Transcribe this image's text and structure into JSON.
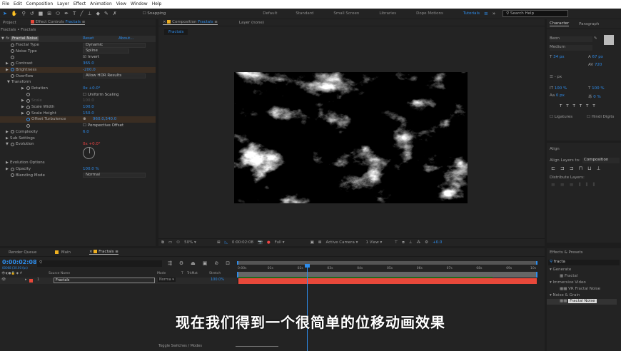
{
  "menu": [
    "File",
    "Edit",
    "Composition",
    "Layer",
    "Effect",
    "Animation",
    "View",
    "Window",
    "Help"
  ],
  "toolbar": {
    "snapping": "Snapping",
    "workspaces": [
      "Default",
      "Standard",
      "Small Screen",
      "Libraries",
      "Dope Motions",
      "Tutorials"
    ],
    "active_workspace": "Tutorials",
    "search_placeholder": "Search Help"
  },
  "left": {
    "tab_project": "Project",
    "tab_effect": "Effect Controls",
    "tab_effect_layer": "Fractals",
    "crumb": "Fractals • Fractals",
    "effect_name": "Fractal Noise",
    "reset": "Reset",
    "about": "About...",
    "props": [
      {
        "label": "Fractal Type",
        "value": "Dynamic",
        "type": "dropdown"
      },
      {
        "label": "Noise Type",
        "value": "Spline",
        "type": "dropdown"
      },
      {
        "label": "",
        "value": "Invert",
        "type": "checkbox",
        "checked": true
      },
      {
        "label": "Contrast",
        "value": "365.0"
      },
      {
        "label": "Brightness",
        "value": "-200.0"
      },
      {
        "label": "Overflow",
        "value": "Allow HDR Results",
        "type": "dropdown"
      },
      {
        "label": "Transform",
        "value": ""
      },
      {
        "label": "Rotation",
        "value": "0x +0.0°"
      },
      {
        "label": "",
        "value": "Uniform Scaling",
        "type": "checkbox",
        "checked": false
      },
      {
        "label": "Scale",
        "value": "100.0"
      },
      {
        "label": "Scale Width",
        "value": "100.0"
      },
      {
        "label": "Scale Height",
        "value": "150.0"
      },
      {
        "label": "Offset Turbulence",
        "value": "960.0,540.0"
      },
      {
        "label": "",
        "value": "Perspective Offset",
        "type": "checkbox",
        "checked": false
      },
      {
        "label": "Complexity",
        "value": "6.0"
      },
      {
        "label": "Sub Settings",
        "value": ""
      },
      {
        "label": "Evolution",
        "value": "0x +0.0°"
      },
      {
        "label": "",
        "value": ""
      },
      {
        "label": "",
        "value": ""
      },
      {
        "label": "Evolution Options",
        "value": ""
      },
      {
        "label": "Opacity",
        "value": "100.0 %"
      },
      {
        "label": "Blending Mode",
        "value": "Normal",
        "type": "dropdown"
      }
    ]
  },
  "viewer": {
    "tab_comp": "Composition",
    "comp_name": "Fractals",
    "tab_layer": "Layer (none)",
    "comp_chip": "Fractals",
    "zoom": "50%",
    "timecode": "0:00:02:08",
    "resolution": "Full",
    "camera": "Active Camera",
    "views": "1 View",
    "exposure": "+0.0"
  },
  "character": {
    "tab": "Character",
    "tab2": "Paragraph",
    "font": "Beon",
    "style": "Medium",
    "size": "34 px",
    "leading": "67 px",
    "tracking": "720",
    "stroke": "- px",
    "vscale": "100 %",
    "hscale": "100 %",
    "baseline": "0 px",
    "tsume": "0 %",
    "ligatures": "Ligatures",
    "hindi": "Hindi Digits"
  },
  "align": {
    "title": "Align",
    "align_to_label": "Align Layers to:",
    "align_to": "Composition",
    "distribute": "Distribute Layers:"
  },
  "effects": {
    "title": "Effects & Presets",
    "search": "fracta",
    "groups": [
      {
        "name": "Generate",
        "items": [
          "Fractal"
        ]
      },
      {
        "name": "Immersive Video",
        "items": [
          "VR Fractal Noise"
        ]
      },
      {
        "name": "Noise & Grain",
        "items": [
          "Fractal Noise"
        ]
      }
    ]
  },
  "timeline": {
    "tab_render": "Render Queue",
    "tab_main": "Main",
    "tab_fractals": "Fractals",
    "timecode": "0:00:02:08",
    "frames": "00068 (30.00 fps)",
    "cols": [
      "Source Name",
      "Mode",
      "T",
      "TrkMat",
      "Stretch"
    ],
    "layer": {
      "num": "1",
      "name": "Fractals",
      "mode": "Norma",
      "stretch": "100.0%"
    },
    "ticks": [
      "0:00s",
      "01s",
      "02s",
      "03s",
      "04s",
      "05s",
      "06s",
      "07s",
      "08s",
      "09s",
      "10s"
    ],
    "toggle": "Toggle Switches / Modes"
  },
  "subtitle": "现在我们得到一个很简单的位移动画效果",
  "colors": {
    "accent": "#2d8ceb",
    "layer_bar": "#e8483a",
    "work_area": "#1e6b1e"
  }
}
